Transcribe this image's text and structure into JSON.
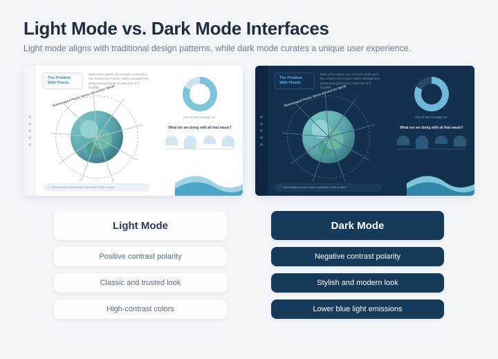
{
  "title": "Light Mode vs. Dark Mode Interfaces",
  "subtitle": "Light mode aligns with traditional design patterns, while dark mode curates a unique user experience.",
  "preview": {
    "tag": "The Problem With Plastic",
    "blurb": "Most of the plastic we consume ends up in the oceans due to poor waste management, plastic being littered or disposed of in landfills.",
    "arc": "Mismanaged Plastic Waste Around the World",
    "question": "What are we doing with all that waste?",
    "donut_caption": "65% of that message etc."
  },
  "light": {
    "heading": "Light Mode",
    "items": [
      "Positive contrast polarity",
      "Classic and trusted look",
      "High-contrast colors"
    ]
  },
  "dark": {
    "heading": "Dark Mode",
    "items": [
      "Negative contrast polarity",
      "Stylish and modern look",
      "Lower blue light emissions"
    ]
  }
}
